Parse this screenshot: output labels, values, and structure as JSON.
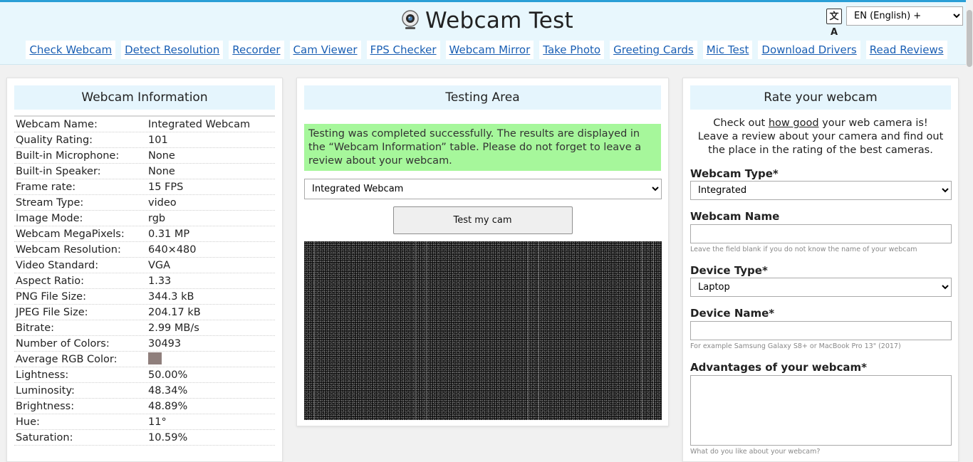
{
  "header": {
    "title": "Webcam Test",
    "language": "EN (English) +",
    "nav": [
      "Check Webcam",
      "Detect Resolution",
      "Recorder",
      "Cam Viewer",
      "FPS Checker",
      "Webcam Mirror",
      "Take Photo",
      "Greeting Cards",
      "Mic Test",
      "Download Drivers",
      "Read Reviews"
    ]
  },
  "info": {
    "heading": "Webcam Information",
    "rows": [
      {
        "label": "Webcam Name:",
        "value": "Integrated Webcam"
      },
      {
        "label": "Quality Rating:",
        "value": "101"
      },
      {
        "label": "Built-in Microphone:",
        "value": "None"
      },
      {
        "label": "Built-in Speaker:",
        "value": "None"
      },
      {
        "label": "Frame rate:",
        "value": "15 FPS"
      },
      {
        "label": "Stream Type:",
        "value": "video"
      },
      {
        "label": "Image Mode:",
        "value": "rgb"
      },
      {
        "label": "Webcam MegaPixels:",
        "value": "0.31 MP"
      },
      {
        "label": "Webcam Resolution:",
        "value": "640×480"
      },
      {
        "label": "Video Standard:",
        "value": "VGA"
      },
      {
        "label": "Aspect Ratio:",
        "value": "1.33"
      },
      {
        "label": "PNG File Size:",
        "value": "344.3 kB"
      },
      {
        "label": "JPEG File Size:",
        "value": "204.17 kB"
      },
      {
        "label": "Bitrate:",
        "value": "2.99 MB/s"
      },
      {
        "label": "Number of Colors:",
        "value": "30493"
      },
      {
        "label": "Average RGB Color:",
        "value": ""
      },
      {
        "label": "Lightness:",
        "value": "50.00%"
      },
      {
        "label": "Luminosity:",
        "value": "48.34%"
      },
      {
        "label": "Brightness:",
        "value": "48.89%"
      },
      {
        "label": "Hue:",
        "value": "11°"
      },
      {
        "label": "Saturation:",
        "value": "10.59%"
      }
    ],
    "avg_rgb_color": "#8f7f7c"
  },
  "testing": {
    "heading": "Testing Area",
    "success_message": "Testing was completed successfully. The results are displayed in the “Webcam Information” table. Please do not forget to leave a review about your webcam.",
    "camera_selected": "Integrated Webcam",
    "test_button": "Test my cam"
  },
  "rate": {
    "heading": "Rate your webcam",
    "intro_before": "Check out ",
    "intro_link": "how good",
    "intro_after": " your web camera is!",
    "intro_line2": "Leave a review about your camera and find out the place in the rating of the best cameras.",
    "webcam_type_label": "Webcam Type*",
    "webcam_type_value": "Integrated",
    "webcam_name_label": "Webcam Name",
    "webcam_name_hint": "Leave the field blank if you do not know the name of your webcam",
    "device_type_label": "Device Type*",
    "device_type_value": "Laptop",
    "device_name_label": "Device Name*",
    "device_name_hint": "For example Samsung Galaxy S8+ or MacBook Pro 13\" (2017)",
    "advantages_label": "Advantages of your webcam*",
    "advantages_hint": "What do you like about your webcam?"
  },
  "colors": {
    "accent": "#2a9fd6",
    "header_bg": "#e8f7fd",
    "panel_head_bg": "#e5f5fd",
    "success_bg": "#a6f79b",
    "link": "#1a5fb4"
  }
}
